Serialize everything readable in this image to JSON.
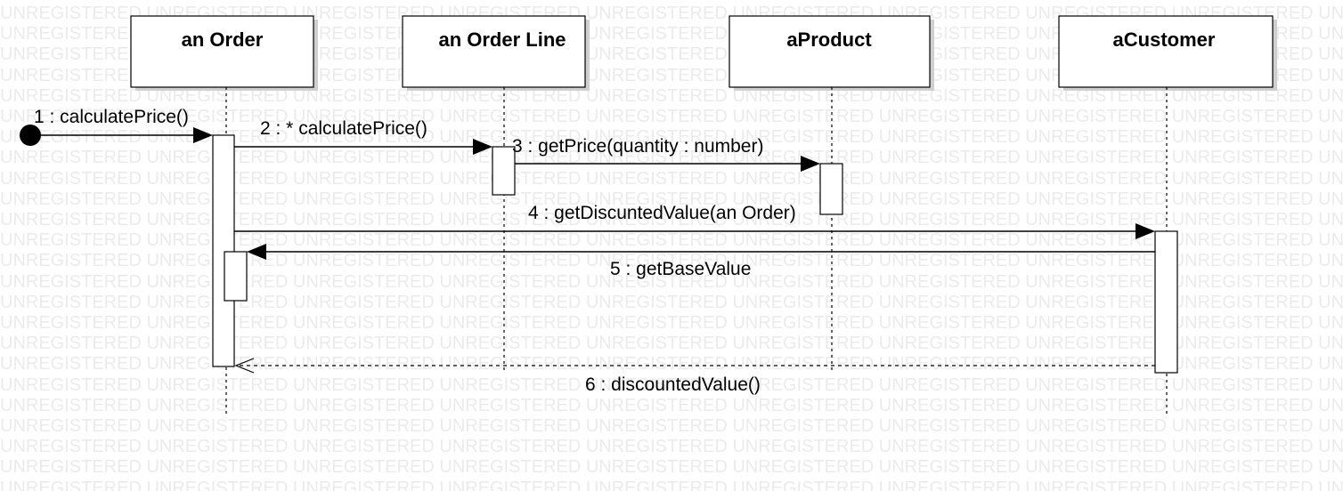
{
  "watermark": {
    "text": "UNREGISTERED"
  },
  "lifelines": [
    {
      "id": "order",
      "title": "an Order"
    },
    {
      "id": "orderline",
      "title": "an Order Line"
    },
    {
      "id": "product",
      "title": "aProduct"
    },
    {
      "id": "customer",
      "title": "aCustomer"
    }
  ],
  "messages": [
    {
      "n": 1,
      "label": "1 : calculatePrice()",
      "kind": "found",
      "from": "start",
      "to": "order"
    },
    {
      "n": 2,
      "label": "2 : * calculatePrice()",
      "kind": "call",
      "from": "order",
      "to": "orderline"
    },
    {
      "n": 3,
      "label": "3 : getPrice(quantity : number)",
      "kind": "call",
      "from": "orderline",
      "to": "product"
    },
    {
      "n": 4,
      "label": "4 : getDiscuntedValue(an Order)",
      "kind": "call",
      "from": "order",
      "to": "customer"
    },
    {
      "n": 5,
      "label": "5 : getBaseValue",
      "kind": "call",
      "from": "customer",
      "to": "order"
    },
    {
      "n": 6,
      "label": "6 : discountedValue()",
      "kind": "return",
      "from": "customer",
      "to": "order"
    }
  ],
  "colors": {
    "line": "#000000",
    "watermark": "#ebebeb",
    "background": "#ffffff"
  }
}
